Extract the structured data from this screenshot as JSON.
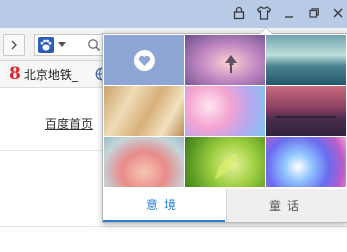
{
  "bookmarks": [
    {
      "number": "8",
      "label": "北京地铁_"
    }
  ],
  "content": {
    "home_link": "百度首页"
  },
  "skin_popup": {
    "thumbnails": [
      {
        "name": "custom",
        "icon": "heart-icon"
      },
      {
        "name": "sunset-tree"
      },
      {
        "name": "lake-dusk"
      },
      {
        "name": "golden-grass"
      },
      {
        "name": "cherry-blossom"
      },
      {
        "name": "pier-sunset"
      },
      {
        "name": "blurred-bokeh"
      },
      {
        "name": "green-leaf"
      },
      {
        "name": "blue-bokeh"
      }
    ],
    "tabs": [
      {
        "label": "意境",
        "active": true
      },
      {
        "label": "童话",
        "active": false
      }
    ]
  },
  "accent_color": "#2a7fd4"
}
